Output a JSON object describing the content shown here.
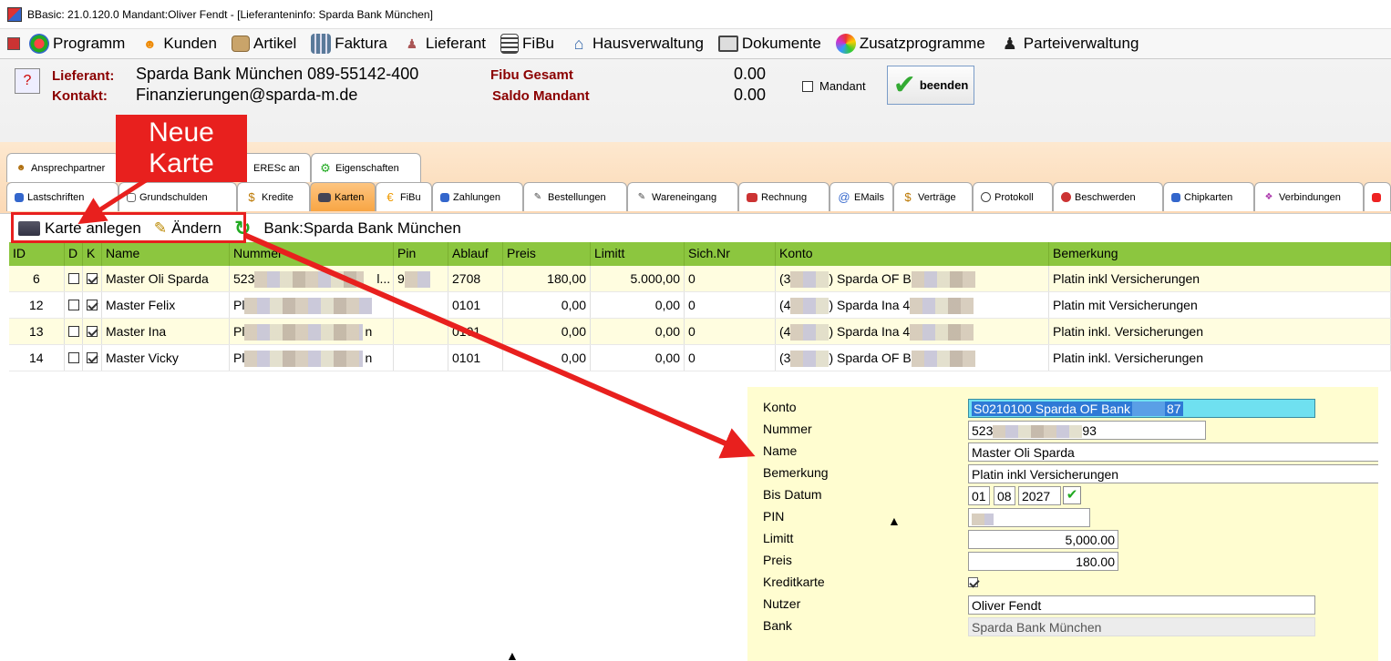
{
  "window": {
    "title": "BBasic: 21.0.120.0 Mandant:Oliver Fendt  - [Lieferanteninfo: Sparda Bank München]"
  },
  "menu": {
    "items": [
      {
        "label": "Programm",
        "icon": "globe-icon"
      },
      {
        "label": "Kunden",
        "icon": "users-icon"
      },
      {
        "label": "Artikel",
        "icon": "box-icon"
      },
      {
        "label": "Faktura",
        "icon": "building-icon"
      },
      {
        "label": "Lieferant",
        "icon": "person-icon"
      },
      {
        "label": "FiBu",
        "icon": "ledger-icon"
      },
      {
        "label": "Hausverwaltung",
        "icon": "house-icon"
      },
      {
        "label": "Dokumente",
        "icon": "document-icon"
      },
      {
        "label": "Zusatzprogramme",
        "icon": "puzzle-icon"
      },
      {
        "label": "Parteiverwaltung",
        "icon": "figure-icon"
      }
    ]
  },
  "header": {
    "lieferant_label": "Lieferant:",
    "lieferant_value": "Sparda Bank München 089-55142-400",
    "kontakt_label": "Kontakt:",
    "kontakt_value": "Finanzierungen@sparda-m.de",
    "fibu_label": "Fibu Gesamt",
    "fibu_value": "0.00",
    "saldo_label": "Saldo Mandant",
    "saldo_value": "0.00",
    "mandant_label": "Mandant",
    "beenden_label": "beenden"
  },
  "tabs_row1": [
    {
      "label": "Ansprechpartner"
    },
    {
      "label": "ERESc an"
    },
    {
      "label": "Eigenschaften"
    }
  ],
  "tabs_row2": [
    {
      "label": "Lastschriften"
    },
    {
      "label": "Grundschulden"
    },
    {
      "label": "Kredite"
    },
    {
      "label": "Karten"
    },
    {
      "label": "FiBu"
    },
    {
      "label": "Zahlungen"
    },
    {
      "label": "Bestellungen"
    },
    {
      "label": "Wareneingang"
    },
    {
      "label": "Rechnung"
    },
    {
      "label": "EMails"
    },
    {
      "label": "Verträge"
    },
    {
      "label": "Protokoll"
    },
    {
      "label": "Beschwerden"
    },
    {
      "label": "Chipkarten"
    },
    {
      "label": "Verbindungen"
    }
  ],
  "toolbar": {
    "add_label": "Karte anlegen",
    "edit_label": "Ändern",
    "bank_label": "Bank:Sparda Bank München"
  },
  "grid": {
    "columns": [
      "ID",
      "D",
      "K",
      "Name",
      "Nummer",
      "Pin",
      "Ablauf",
      "Preis",
      "Limitt",
      "Sich.Nr",
      "Konto",
      "Bemerkung"
    ],
    "rows": [
      {
        "id": "6",
        "name": "Master Oli Sparda",
        "nummer": "523",
        "nummer_end": "l...",
        "pin": "9",
        "ablauf": "2708",
        "preis": "180,00",
        "limitt": "5.000,00",
        "sichnr": "0",
        "konto_pre": "(3",
        "konto": ") Sparda OF B",
        "bemerkung": "Platin inkl Versicherungen"
      },
      {
        "id": "12",
        "name": "Master Felix",
        "nummer": "Pl",
        "nummer_end": "",
        "pin": "",
        "ablauf": "0101",
        "preis": "0,00",
        "limitt": "0,00",
        "sichnr": "0",
        "konto_pre": "(4",
        "konto": ") Sparda Ina 4",
        "bemerkung": "Platin mit Versicherungen"
      },
      {
        "id": "13",
        "name": "Master Ina",
        "nummer": "Pl",
        "nummer_end": "n",
        "pin": "",
        "ablauf": "0101",
        "preis": "0,00",
        "limitt": "0,00",
        "sichnr": "0",
        "konto_pre": "(4",
        "konto": ") Sparda Ina 4",
        "bemerkung": "Platin inkl. Versicherungen"
      },
      {
        "id": "14",
        "name": "Master Vicky",
        "nummer": "Pl",
        "nummer_end": "n",
        "pin": "",
        "ablauf": "0101",
        "preis": "0,00",
        "limitt": "0,00",
        "sichnr": "0",
        "konto_pre": "(3",
        "konto": ") Sparda OF B",
        "bemerkung": "Platin inkl. Versicherungen"
      }
    ]
  },
  "detail": {
    "konto_label": "Konto",
    "konto_value": "S0210100 Sparda OF Bank",
    "konto_suffix": "87",
    "nummer_label": "Nummer",
    "nummer_prefix": "523",
    "nummer_suffix": "93",
    "name_label": "Name",
    "name_value": "Master Oli Sparda",
    "bemerkung_label": "Bemerkung",
    "bemerkung_value": "Platin inkl Versicherungen",
    "bisdatum_label": "Bis Datum",
    "bisdatum_day": "01",
    "bisdatum_month": "08",
    "bisdatum_year": "2027",
    "pin_label": "PIN",
    "limitt_label": "Limitt",
    "limitt_value": "5,000.00",
    "preis_label": "Preis",
    "preis_value": "180.00",
    "kreditkarte_label": "Kreditkarte",
    "nutzer_label": "Nutzer",
    "nutzer_value": "Oliver Fendt",
    "bank_label": "Bank",
    "bank_value": "Sparda Bank München"
  },
  "annotation": {
    "callout_line1": "Neue",
    "callout_line2": "Karte"
  },
  "colors": {
    "grid_header": "#8cc63f",
    "annotation_red": "#e8201e",
    "detail_bg": "#fffdd0",
    "active_tab": "#f8a644"
  }
}
